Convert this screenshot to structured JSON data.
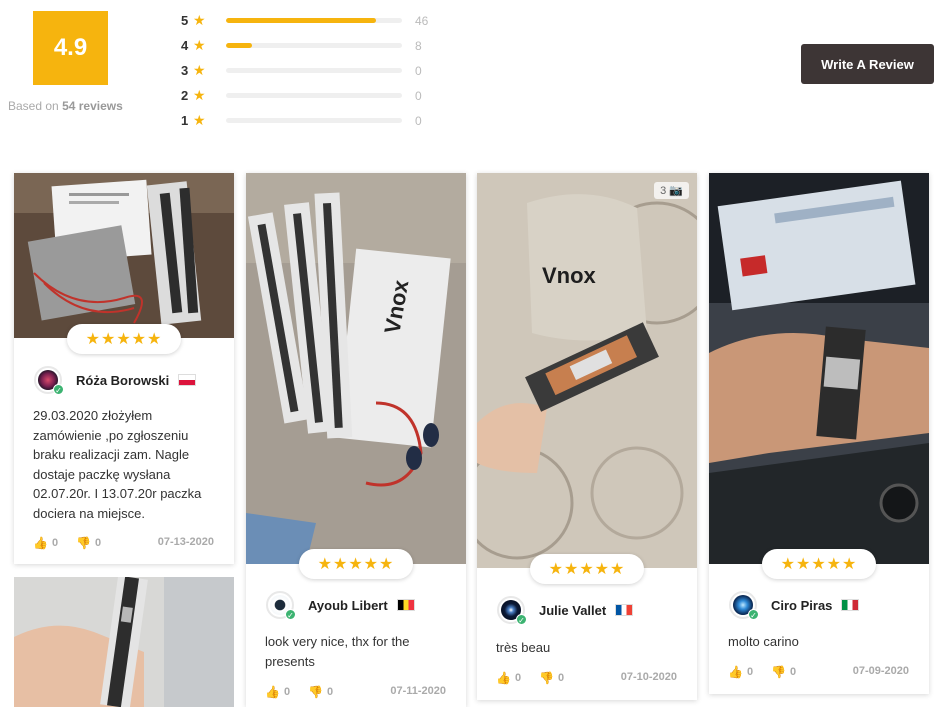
{
  "summary": {
    "average": "4.9",
    "based_on_prefix": "Based on",
    "based_on_count": "54 reviews",
    "distribution": [
      {
        "stars": "5",
        "count": "46",
        "fraction": 0.852
      },
      {
        "stars": "4",
        "count": "8",
        "fraction": 0.148
      },
      {
        "stars": "3",
        "count": "0",
        "fraction": 0
      },
      {
        "stars": "2",
        "count": "0",
        "fraction": 0
      },
      {
        "stars": "1",
        "count": "0",
        "fraction": 0
      }
    ],
    "write_review_label": "Write A Review"
  },
  "colors": {
    "accent": "#f6b40e",
    "button": "#3d3535",
    "verified": "#3cb371"
  },
  "reviews": [
    {
      "name": "Róża Borowski",
      "flag": "poland",
      "stars": "★★★★★",
      "text": "29.03.2020 złożyłem zamówienie ,po zgłoszeniu braku realizacji zam. Nagle dostaje paczkę wysłana 02.07.20r. I 13.07.20r paczka dociera na miejsce.",
      "likes": "0",
      "dislikes": "0",
      "date": "07-13-2020"
    },
    {
      "name": "Ayoub Libert",
      "flag": "belgium",
      "stars": "★★★★★",
      "text": "look very nice, thx for the presents",
      "likes": "0",
      "dislikes": "0",
      "date": "07-11-2020"
    },
    {
      "name": "Julie Vallet",
      "flag": "france",
      "stars": "★★★★★",
      "text": "très beau",
      "likes": "0",
      "dislikes": "0",
      "date": "07-10-2020",
      "photo_count": "3"
    },
    {
      "name": "Ciro Piras",
      "flag": "italy",
      "stars": "★★★★★",
      "text": "molto carino",
      "likes": "0",
      "dislikes": "0",
      "date": "07-09-2020"
    }
  ],
  "icons": {
    "star": "★",
    "thumb_up": "👍",
    "thumb_down": "👎",
    "check": "✓",
    "camera": "📷"
  }
}
